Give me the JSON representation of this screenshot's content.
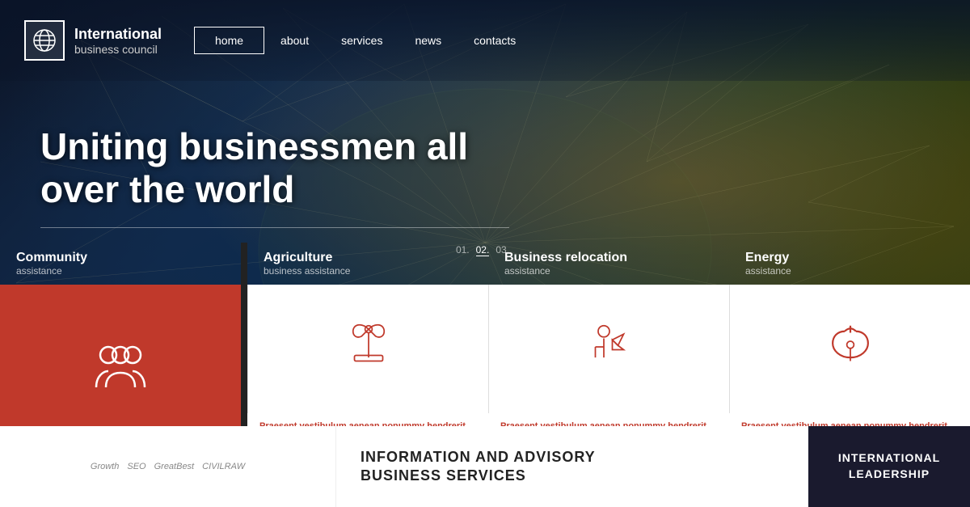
{
  "header": {
    "logo_icon": "globe-icon",
    "brand_name": "International",
    "brand_sub": "business council",
    "nav": [
      {
        "label": "home",
        "active": true,
        "id": "home"
      },
      {
        "label": "about",
        "active": false,
        "id": "about"
      },
      {
        "label": "services",
        "active": false,
        "id": "services"
      },
      {
        "label": "news",
        "active": false,
        "id": "news"
      },
      {
        "label": "contacts",
        "active": false,
        "id": "contacts"
      }
    ]
  },
  "hero": {
    "title": "Uniting businessmen all over the world",
    "pagination": [
      "01.",
      "02.",
      "03."
    ],
    "active_page": 1
  },
  "services": [
    {
      "id": "community",
      "title": "Community",
      "subtitle": "assistance",
      "icon": "people-icon",
      "variant": "red",
      "desc": ""
    },
    {
      "id": "agriculture",
      "title": "Agriculture",
      "subtitle": "business assistance",
      "icon": "apple-icon",
      "variant": "white",
      "desc": "Praesent vestibulum aenean nonummy hendrerit mauris. Hasellus porta."
    },
    {
      "id": "relocation",
      "title": "Business relocation",
      "subtitle": "assistance",
      "icon": "puzzle-person-icon",
      "variant": "white",
      "desc": "Praesent vestibulum aenean nonummy hendrerit mauris. Hasellus porta."
    },
    {
      "id": "energy",
      "title": "Energy",
      "subtitle": "assistance",
      "icon": "touch-icon",
      "variant": "white",
      "desc": "Praesent vestibulum aenean nonummy hendrerit mauris. Hasellus porta."
    }
  ],
  "bottom": {
    "logos": [
      "Growth",
      "SEO",
      "GreatBest",
      "CIVILRAW"
    ],
    "info_title": "INFORMATION AND ADVISORY\nBUSINESS SERVICES",
    "intl_label": "INTERNATIONAL\nLeadership"
  }
}
